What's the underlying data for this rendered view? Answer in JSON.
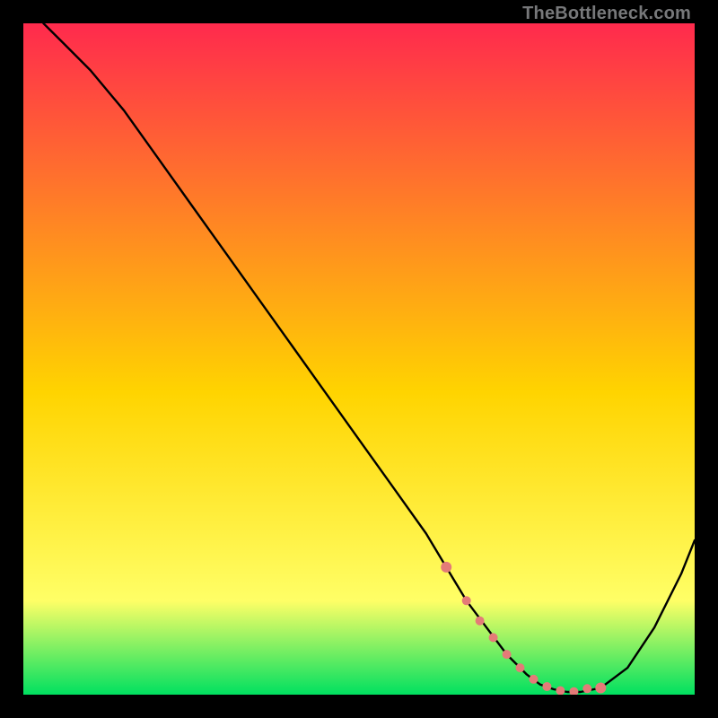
{
  "attribution": "TheBottleneck.com",
  "colors": {
    "top": "#ff2a4d",
    "mid": "#ffd400",
    "low_yellow": "#ffff66",
    "green": "#00e060",
    "curve_stroke": "#000000",
    "marker_fill": "#e47b78",
    "background": "#000000"
  },
  "chart_data": {
    "type": "line",
    "title": "",
    "xlabel": "",
    "ylabel": "",
    "xlim": [
      0,
      100
    ],
    "ylim": [
      0,
      100
    ],
    "series": [
      {
        "name": "bottleneck-curve",
        "x": [
          3,
          6,
          10,
          15,
          20,
          25,
          30,
          35,
          40,
          45,
          50,
          55,
          60,
          63,
          66,
          69,
          72,
          75,
          77,
          79,
          81,
          83,
          86,
          90,
          94,
          98,
          100
        ],
        "y": [
          100,
          97,
          93,
          87,
          80,
          73,
          66,
          59,
          52,
          45,
          38,
          31,
          24,
          19,
          14,
          10,
          6,
          3,
          1.5,
          0.8,
          0.4,
          0.4,
          1.0,
          4,
          10,
          18,
          23
        ]
      }
    ],
    "markers": {
      "name": "optimal-range",
      "x": [
        63,
        66,
        68,
        70,
        72,
        74,
        76,
        78,
        80,
        82,
        84,
        86
      ],
      "y": [
        19,
        14,
        11,
        8.5,
        6,
        4,
        2.3,
        1.2,
        0.6,
        0.45,
        0.9,
        1.0
      ]
    }
  }
}
